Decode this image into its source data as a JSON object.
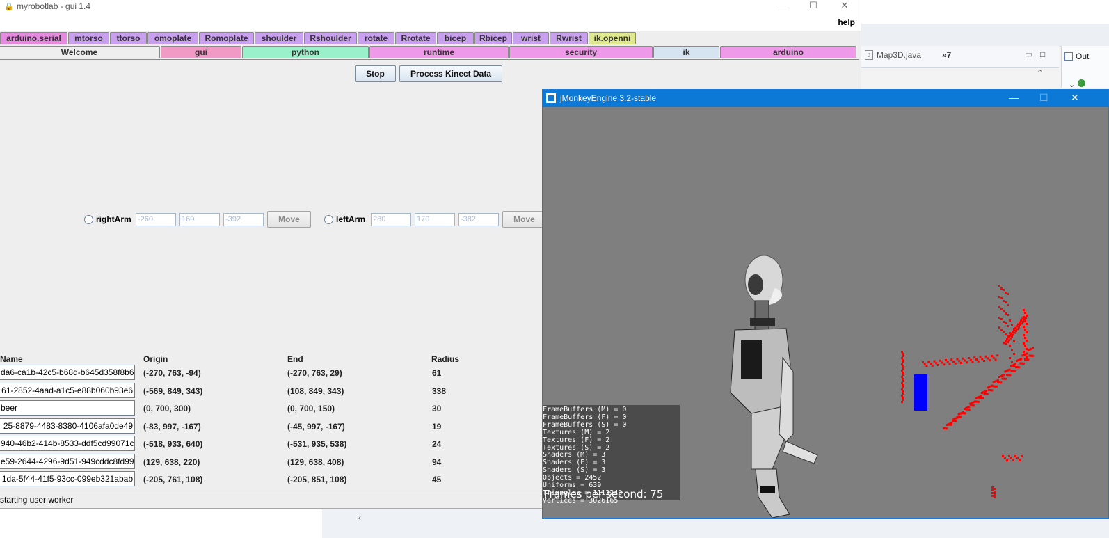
{
  "mrl": {
    "title": "myrobotlab - gui 1.4",
    "help": "help",
    "tabs_row1": [
      {
        "label": "arduino.serial",
        "color": "#e68ae0"
      },
      {
        "label": "mtorso",
        "color": "#c9a0f0"
      },
      {
        "label": "ttorso",
        "color": "#c9a0f0"
      },
      {
        "label": "omoplate",
        "color": "#c9a0f0"
      },
      {
        "label": "Romoplate",
        "color": "#c9a0f0"
      },
      {
        "label": "shoulder",
        "color": "#c9a0f0"
      },
      {
        "label": "Rshoulder",
        "color": "#c9a0f0"
      },
      {
        "label": "rotate",
        "color": "#c9a0f0"
      },
      {
        "label": "Rrotate",
        "color": "#c9a0f0"
      },
      {
        "label": "bicep",
        "color": "#c9a0f0"
      },
      {
        "label": "Rbicep",
        "color": "#c9a0f0"
      },
      {
        "label": "wrist",
        "color": "#c9a0f0"
      },
      {
        "label": "Rwrist",
        "color": "#c9a0f0"
      },
      {
        "label": "ik.openni",
        "color": "#dfe88a"
      }
    ],
    "tabs_row2": [
      {
        "label": "Welcome",
        "color": "#eeeeee"
      },
      {
        "label": "gui",
        "color": "#f29ac6"
      },
      {
        "label": "python",
        "color": "#9af0c8"
      },
      {
        "label": "runtime",
        "color": "#ee9ae8"
      },
      {
        "label": "security",
        "color": "#ee9ae8"
      },
      {
        "label": "ik",
        "color": "#d6e4f2"
      },
      {
        "label": "arduino",
        "color": "#ee9ae8"
      }
    ],
    "buttons": {
      "stop": "Stop",
      "process": "Process Kinect Data"
    },
    "right_arm": {
      "label": "rightArm",
      "x": "-260",
      "y": "169",
      "z": "-392",
      "move": "Move"
    },
    "left_arm": {
      "label": "leftArm",
      "x": "280",
      "y": "170",
      "z": "-382",
      "move": "Move"
    },
    "table": {
      "headers": [
        "Name",
        "Origin",
        "End",
        "Radius"
      ],
      "rows": [
        {
          "name": "da6-ca1b-42c5-b68d-b645d358f8b6",
          "origin": "(-270, 763, -94)",
          "end": "(-270, 763, 29)",
          "radius": "61"
        },
        {
          "name": "61-2852-4aad-a1c5-e88b060b93e6",
          "origin": "(-569, 849, 343)",
          "end": "(108, 849, 343)",
          "radius": "338"
        },
        {
          "name": "beer",
          "origin": "(0, 700, 300)",
          "end": "(0, 700, 150)",
          "radius": "30"
        },
        {
          "name": "25-8879-4483-8380-4106afa0de49",
          "origin": "(-83, 997, -167)",
          "end": "(-45, 997, -167)",
          "radius": "19"
        },
        {
          "name": "940-46b2-414b-8533-ddf5cd99071c",
          "origin": "(-518, 933, 640)",
          "end": "(-531, 935, 538)",
          "radius": "24"
        },
        {
          "name": "e59-2644-4296-9d51-949cddc8fd99",
          "origin": "(129, 638, 220)",
          "end": "(129, 638, 408)",
          "radius": "94"
        },
        {
          "name": "1da-5f44-41f5-93cc-099eb321abab",
          "origin": "(-205, 761, 108)",
          "end": "(-205, 851, 108)",
          "radius": "45"
        }
      ]
    },
    "status": "starting user worker"
  },
  "jme": {
    "title": "jMonkeyEngine 3.2-stable",
    "stats": [
      "FrameBuffers (M) = 0",
      "FrameBuffers (F) = 0",
      "FrameBuffers (S) = 0",
      "Textures (M) = 2",
      "Textures (F) = 2",
      "Textures (S) = 2",
      "Shaders (M) = 3",
      "Shaders (F) = 3",
      "Shaders (S) = 3",
      "Objects = 2452",
      "Uniforms = 639",
      "Triangles = 1113240",
      "Vertices = 3026165"
    ],
    "fps": "Frames per second: 75",
    "colors": {
      "background": "#7f7f7f",
      "point_cloud": "#ff0000",
      "cylinder": "#0000ff"
    }
  },
  "ide": {
    "tab": "Map3D.java",
    "more": "»7",
    "outline": "Out"
  }
}
